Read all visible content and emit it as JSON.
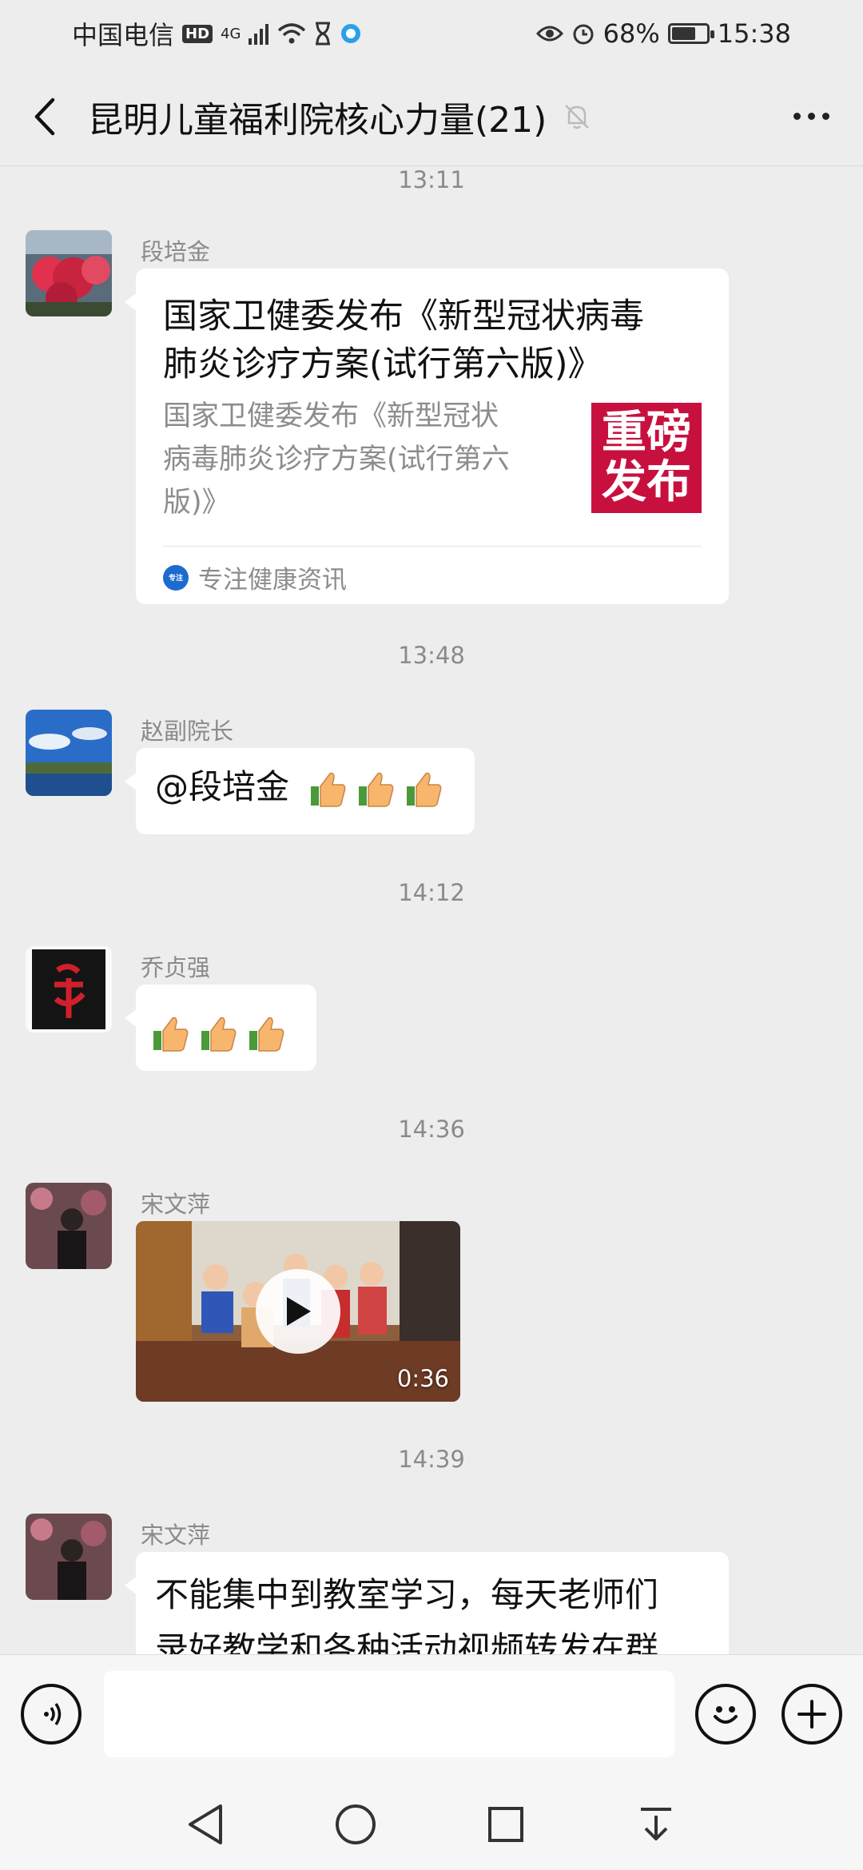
{
  "status_bar": {
    "carrier": "中国电信",
    "network_hd": "HD",
    "network_type": "4G",
    "battery": "68%",
    "battery_level": 0.68,
    "time": "15:38"
  },
  "header": {
    "title": "昆明儿童福利院核心力量(21)",
    "muted": true
  },
  "messages": [
    {
      "type": "time",
      "text": "13:11"
    },
    {
      "type": "link",
      "sender": "段培金",
      "title": "国家卫健委发布《新型冠状病毒肺炎诊疗方案(试行第六版)》",
      "title_line1": "国家卫健委发布《新型冠状病毒",
      "title_line2": "肺炎诊疗方案(试行第六版)》",
      "desc_line1": "国家卫健委发布《新型冠状",
      "desc_line2": "病毒肺炎诊疗方案(试行第六",
      "desc_line3": "版)》",
      "thumb_line1": "重磅",
      "thumb_line2": "发布",
      "source": "专注健康资讯",
      "source_icon_text": "专注"
    },
    {
      "type": "time",
      "text": "13:48"
    },
    {
      "type": "text",
      "sender": "赵副院长",
      "text": "@段培金",
      "thumbs_up": 3
    },
    {
      "type": "time",
      "text": "14:12"
    },
    {
      "type": "text",
      "sender": "乔贞强",
      "text": "",
      "thumbs_up": 3
    },
    {
      "type": "time",
      "text": "14:36"
    },
    {
      "type": "video",
      "sender": "宋文萍",
      "duration": "0:36"
    },
    {
      "type": "time",
      "text": "14:39"
    },
    {
      "type": "text",
      "sender": "宋文萍",
      "line1": "不能集中到教室学习，每天老师们",
      "line2": "录好教学和各种活动视频转发在群"
    }
  ],
  "input_bar": {
    "placeholder": ""
  },
  "colors": {
    "background": "#ededed",
    "bubble": "#ffffff",
    "thumb_red": "#c8103e",
    "secondary_text": "#8a8a8a"
  },
  "icons": {
    "back": "back-arrow-icon",
    "mute": "bell-off-icon",
    "more": "more-dots-icon",
    "voice": "voice-icon",
    "emoji": "emoji-icon",
    "plus": "plus-icon",
    "nav_back": "nav-back-icon",
    "nav_home": "nav-home-icon",
    "nav_recent": "nav-recent-icon",
    "nav_down": "nav-pulldown-icon"
  }
}
